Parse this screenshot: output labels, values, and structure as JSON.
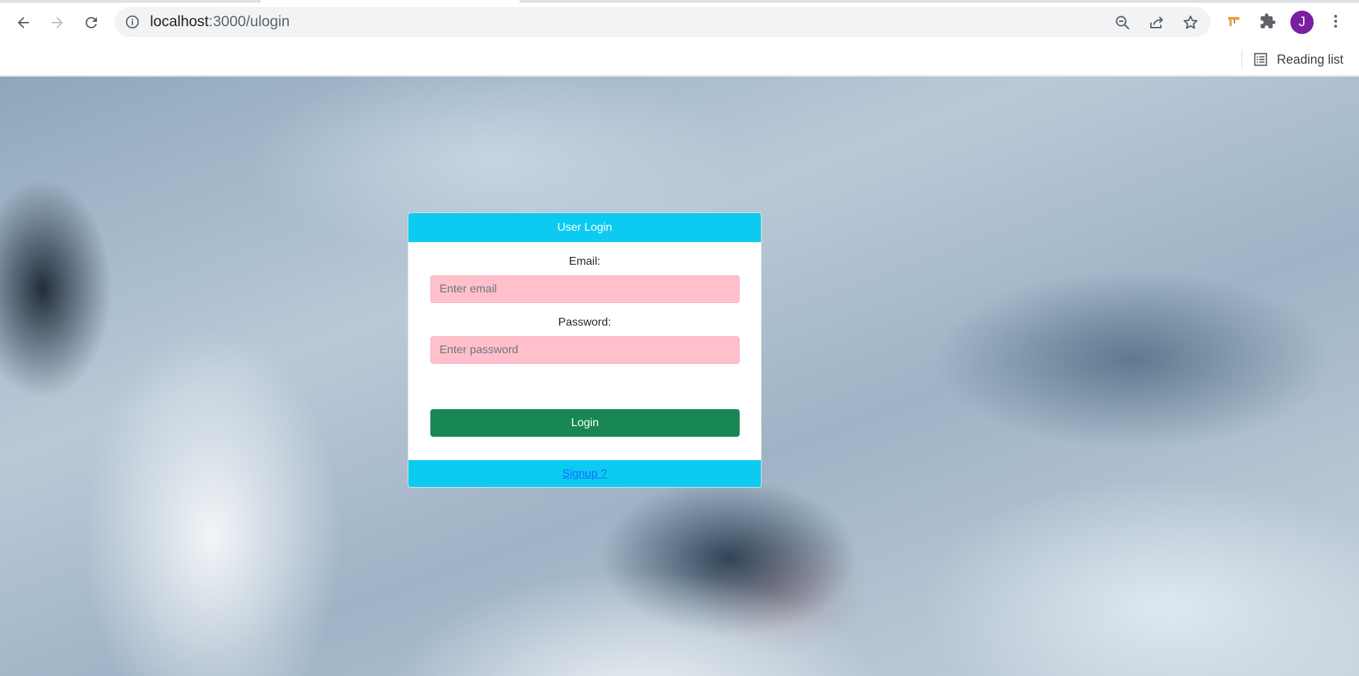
{
  "browser": {
    "url_host": "localhost",
    "url_path": ":3000/ulogin",
    "profile_initial": "J",
    "reading_list_label": "Reading list"
  },
  "login": {
    "header": "User Login",
    "email_label": "Email:",
    "email_placeholder": "Enter email",
    "email_value": "",
    "password_label": "Password:",
    "password_placeholder": "Enter password",
    "password_value": "",
    "submit_label": "Login",
    "signup_link": "Signup ?"
  },
  "colors": {
    "header_bg": "#0dcaf0",
    "input_bg": "#ffc0cb",
    "button_bg": "#198754",
    "link": "#0d6efd",
    "avatar_bg": "#7b1fa2"
  },
  "icons": [
    "back-arrow-icon",
    "forward-arrow-icon",
    "reload-icon",
    "site-info-icon",
    "zoom-out-icon",
    "share-icon",
    "bookmark-star-icon",
    "extension-tool-icon",
    "extensions-puzzle-icon",
    "menu-kebab-icon",
    "reading-list-icon"
  ]
}
